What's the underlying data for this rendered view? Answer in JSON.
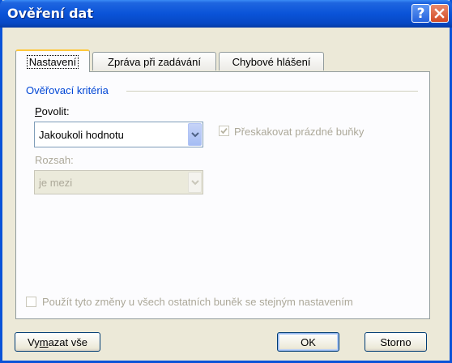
{
  "dialog": {
    "title": "Ověření dat"
  },
  "tabs": [
    {
      "label": "Nastavení",
      "active": true
    },
    {
      "label": "Zpráva při zadávání",
      "active": false
    },
    {
      "label": "Chybové hlášení",
      "active": false
    }
  ],
  "criteria": {
    "group_label": "Ověřovací kritéria",
    "allow_label_underlined": "P",
    "allow_label_rest": "ovolit:",
    "allow_value": "Jakoukoli hodnotu",
    "ignore_blank_label": "Přeskakovat prázdné buňky",
    "ignore_blank_checked": true,
    "range_label": "Rozsah:",
    "range_value": "je mezi"
  },
  "apply_all": {
    "label": "Použít tyto změny u všech ostatních buněk se stejným nastavením",
    "checked": false
  },
  "buttons": {
    "clear_pre": "Vy",
    "clear_underlined": "m",
    "clear_post": "azat vše",
    "ok": "OK",
    "cancel": "Storno"
  },
  "colors": {
    "title_bar": "#0a53d8",
    "group_label": "#0046d5",
    "disabled_text": "#aca899",
    "dialog_bg": "#ece9d8"
  }
}
